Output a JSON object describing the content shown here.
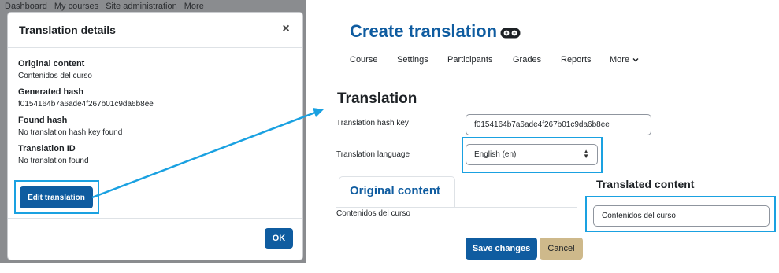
{
  "backdrop": {
    "nav_items": [
      "Dashboard",
      "My courses",
      "Site administration",
      "More"
    ]
  },
  "modal": {
    "title": "Translation details",
    "close_glyph": "×",
    "details": [
      {
        "label": "Original content",
        "value": "Contenidos del curso"
      },
      {
        "label": "Generated hash",
        "value": "f0154164b7a6ade4f267b01c9da6b8ee"
      },
      {
        "label": "Found hash",
        "value": "No translation hash key found"
      },
      {
        "label": "Translation ID",
        "value": "No translation found"
      }
    ],
    "edit_button_label": "Edit translation",
    "ok_button_label": "OK"
  },
  "page": {
    "title": "Create translation",
    "nav": {
      "course": "Course",
      "settings": "Settings",
      "participants": "Participants",
      "grades": "Grades",
      "reports": "Reports",
      "more": "More"
    },
    "section_title": "Translation",
    "form": {
      "hash_key_label": "Translation hash key",
      "hash_key_value": "f0154164b7a6ade4f267b01c9da6b8ee",
      "language_label": "Translation language",
      "language_value": "English (en)",
      "original_tab_label": "Original content",
      "original_text": "Contenidos del curso",
      "translated_title": "Translated content",
      "translated_value": "Contenidos del curso"
    },
    "save_label": "Save changes",
    "cancel_label": "Cancel"
  },
  "colors": {
    "primary": "#0f5ca0",
    "highlight": "#1aa1e1",
    "cancel": "#ceb98b"
  },
  "icons": [
    "close-icon",
    "chevron-down-icon",
    "select-caret-icon",
    "accessibility-badge-icon"
  ]
}
